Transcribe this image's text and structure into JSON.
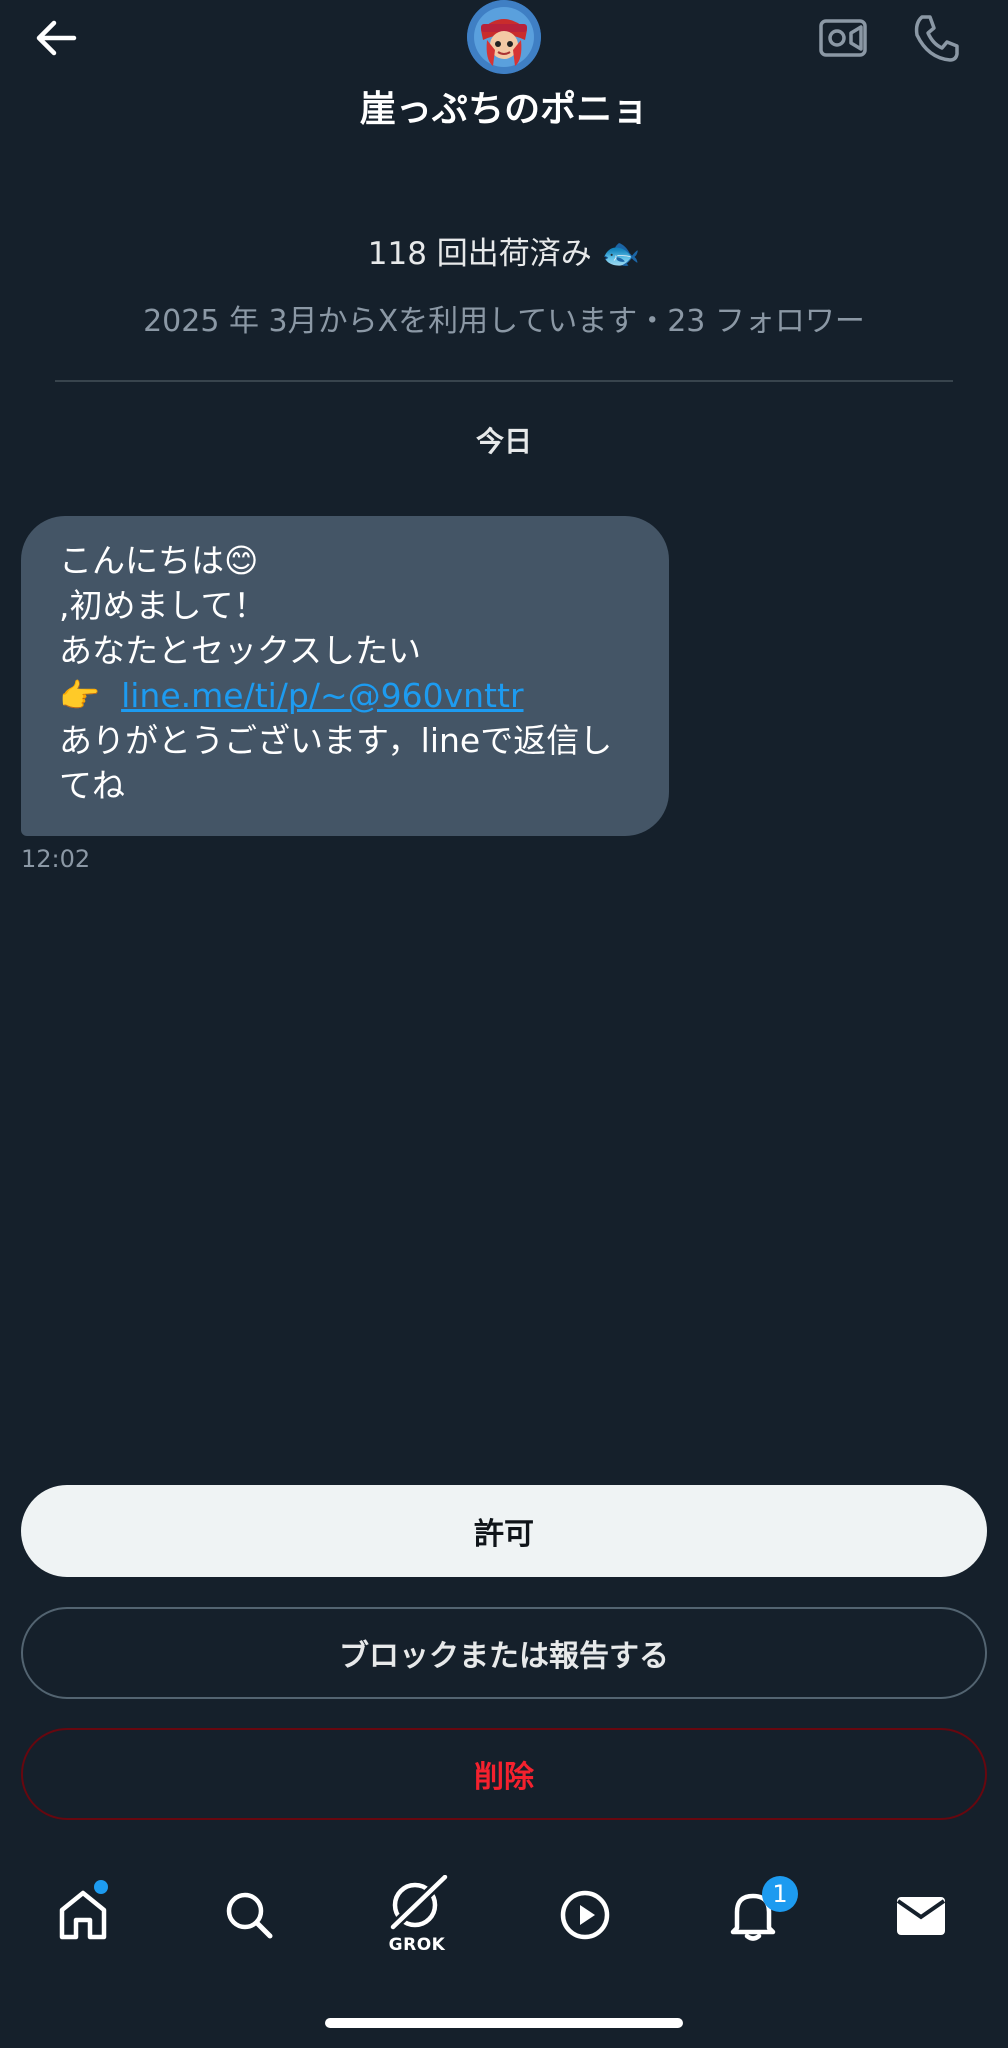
{
  "header": {
    "title": "崖っぷちのポニョ",
    "back_icon": "arrow-left-icon",
    "video_icon": "video-camera-icon",
    "call_icon": "phone-icon"
  },
  "profile": {
    "bio_text": "118 回出荷済み",
    "bio_emoji": "🐟",
    "meta": "2025 年 3月からXを利用しています・23 フォロワー"
  },
  "conversation": {
    "day_label": "今日",
    "message": {
      "line1": "こんにちは",
      "line1_emoji": "😊",
      "line2": ",初めまして！",
      "line3": "あなたとセックスしたい",
      "pointer_emoji": "👉",
      "link": "line.me/ti/p/~@960vnttr",
      "line5": "ありがとうございます，lineで返信し",
      "line6": "てね",
      "time": "12:02"
    }
  },
  "actions": {
    "allow": "許可",
    "block_report": "ブロックまたは報告する",
    "delete": "削除"
  },
  "nav": {
    "items": [
      {
        "icon": "home-icon",
        "has_dot": true
      },
      {
        "icon": "search-icon"
      },
      {
        "icon": "grok-icon",
        "label": "GROK"
      },
      {
        "icon": "play-circle-icon"
      },
      {
        "icon": "bell-icon",
        "badge": "1"
      },
      {
        "icon": "envelope-icon"
      }
    ]
  },
  "colors": {
    "background": "#15202b",
    "bubble": "#445566",
    "link": "#1d9bf0",
    "danger": "#f4212e",
    "muted": "#8b98a5"
  }
}
